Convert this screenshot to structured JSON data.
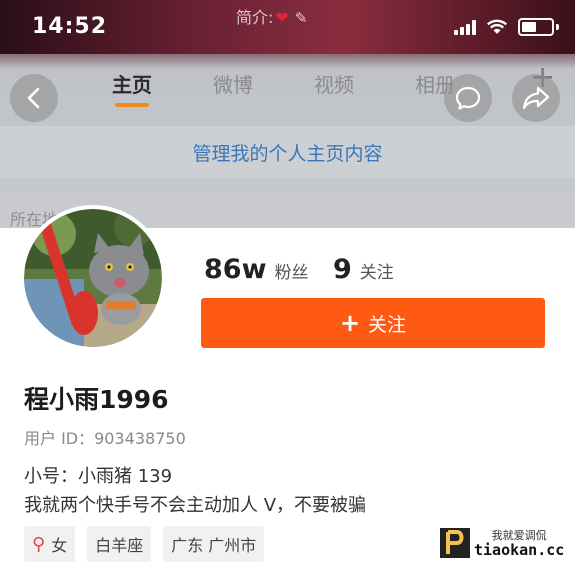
{
  "status_bar": {
    "time": "14:52",
    "intro_label": "简介:",
    "intro_heart": "❤"
  },
  "tabs": [
    {
      "label": "主页",
      "active": true
    },
    {
      "label": "微博",
      "active": false
    },
    {
      "label": "视频",
      "active": false
    },
    {
      "label": "相册",
      "active": false
    }
  ],
  "manage_link": "管理我的个人主页内容",
  "location_label": "所在地：福建",
  "stats": {
    "fans_count": "86w",
    "fans_label": "粉丝",
    "following_count": "9",
    "following_label": "关注"
  },
  "follow_button": {
    "icon": "+",
    "label": "关注"
  },
  "profile": {
    "name": "程小雨1996",
    "user_id": "用户 ID：903438750",
    "bio_line1": "小号：小雨猪 139",
    "bio_line2": "我就两个快手号不会主动加人 V，不要被骗"
  },
  "tags": [
    {
      "label": "女",
      "icon": "female-icon"
    },
    {
      "label": "白羊座"
    },
    {
      "label": "广东 广州市"
    }
  ],
  "watermark": {
    "cn": "我就爱调侃",
    "url": "tiaokan.cc"
  },
  "colors": {
    "accent_orange": "#ff5a14",
    "tab_underline": "#f08a1a",
    "link_blue": "#3a76b8",
    "female_red": "#e8404d"
  }
}
